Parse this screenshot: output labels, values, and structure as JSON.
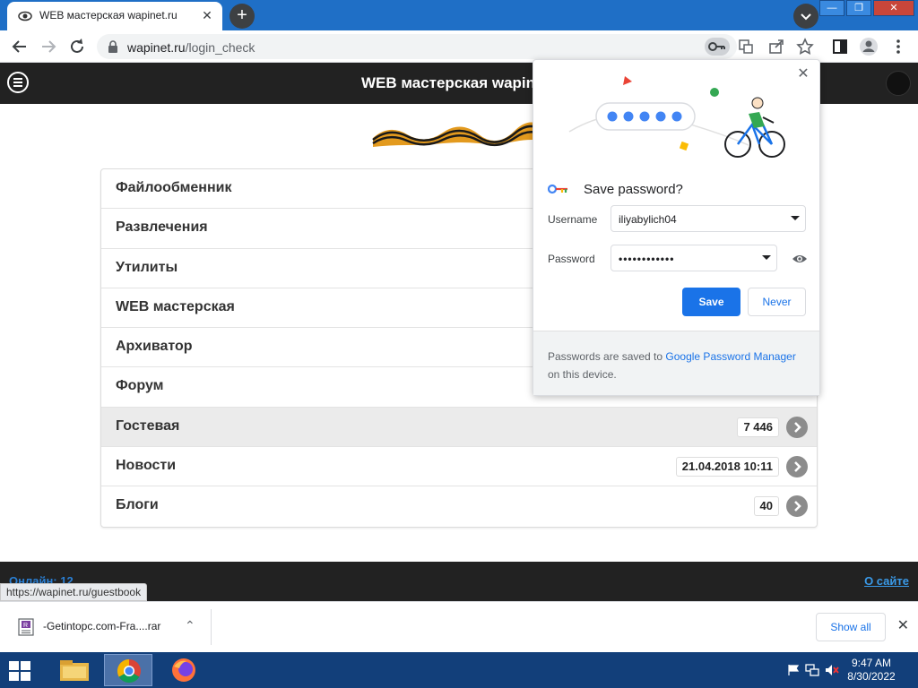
{
  "browser": {
    "tab_title": "WEB мастерская wapinet.ru",
    "tab_close": "✕",
    "newtab_label": "+",
    "url_host": "wapinet.ru",
    "url_path": "/login_check",
    "window_buttons": [
      "—",
      "❐",
      "✕"
    ]
  },
  "site": {
    "header_title": "WEB мастерская wapinet.ru",
    "menu": [
      {
        "label": "Файлообменник"
      },
      {
        "label": "Развлечения"
      },
      {
        "label": "Утилиты"
      },
      {
        "label": "WEB мастерская"
      },
      {
        "label": "Архиватор"
      },
      {
        "label": "Форум"
      },
      {
        "label": "Гостевая",
        "badge": "7 446"
      },
      {
        "label": "Новости",
        "badge": "21.04.2018 10:11"
      },
      {
        "label": "Блоги",
        "badge": "40"
      }
    ],
    "footer_online": "Онлайн: 12",
    "footer_about": "О сайте",
    "status_url": "https://wapinet.ru/guestbook"
  },
  "save_password": {
    "title": "Save password?",
    "username_label": "Username",
    "username_value": "iliyabylich04",
    "password_label": "Password",
    "password_value": "••••••••••••",
    "save_label": "Save",
    "never_label": "Never",
    "footer_prefix": "Passwords are saved to ",
    "footer_link": "Google Password Manager",
    "footer_suffix": " on this device.",
    "close_label": "✕"
  },
  "downloads": {
    "file_name": "-Getintopc.com-Fra....rar",
    "caret": "⌃",
    "show_all": "Show all",
    "close": "✕"
  },
  "taskbar": {
    "time": "9:47 AM",
    "date": "8/30/2022"
  },
  "colors": {
    "tabstrip": "#1f6fc6",
    "accent": "#1a73e8",
    "site_header": "#222222",
    "taskbar": "#123f7a"
  }
}
